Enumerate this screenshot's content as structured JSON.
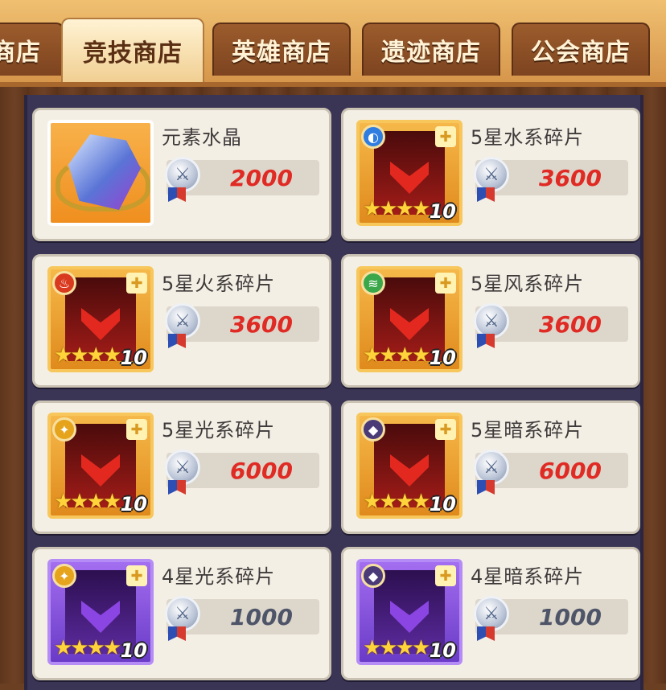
{
  "tabs": [
    {
      "label": "商店",
      "active": false
    },
    {
      "label": "竞技商店",
      "active": true
    },
    {
      "label": "英雄商店",
      "active": false
    },
    {
      "label": "遗迹商店",
      "active": false
    },
    {
      "label": "公会商店",
      "active": false
    }
  ],
  "currency": {
    "icon": "arena-medal-icon",
    "glyph": "⚔"
  },
  "items": [
    {
      "name": "元素水晶",
      "price": "2000",
      "price_color": "#e02a24",
      "thumb": "crystal"
    },
    {
      "name": "5星水系碎片",
      "price": "3600",
      "price_color": "#e02a24",
      "thumb": "orange",
      "element_icon": "water-element-icon",
      "element_glyph": "◐",
      "element_color": "#2f7de0",
      "stars": "★★★★",
      "count": "10"
    },
    {
      "name": "5星火系碎片",
      "price": "3600",
      "price_color": "#e02a24",
      "thumb": "orange",
      "element_icon": "fire-element-icon",
      "element_glyph": "♨",
      "element_color": "#d93a1f",
      "stars": "★★★★",
      "count": "10"
    },
    {
      "name": "5星风系碎片",
      "price": "3600",
      "price_color": "#e02a24",
      "thumb": "orange",
      "element_icon": "wind-element-icon",
      "element_glyph": "≋",
      "element_color": "#3aa84a",
      "stars": "★★★★",
      "count": "10"
    },
    {
      "name": "5星光系碎片",
      "price": "6000",
      "price_color": "#e02a24",
      "thumb": "orange",
      "element_icon": "light-element-icon",
      "element_glyph": "✦",
      "element_color": "#e6a31c",
      "stars": "★★★★",
      "count": "10"
    },
    {
      "name": "5星暗系碎片",
      "price": "6000",
      "price_color": "#e02a24",
      "thumb": "orange",
      "element_icon": "dark-element-icon",
      "element_glyph": "◆",
      "element_color": "#4a3a78",
      "stars": "★★★★",
      "count": "10"
    },
    {
      "name": "4星光系碎片",
      "price": "1000",
      "price_color": "#4f5568",
      "thumb": "purple",
      "element_icon": "light-element-icon",
      "element_glyph": "✦",
      "element_color": "#e6a31c",
      "stars": "★★★★",
      "count": "10"
    },
    {
      "name": "4星暗系碎片",
      "price": "1000",
      "price_color": "#4f5568",
      "thumb": "purple",
      "element_icon": "dark-element-icon",
      "element_glyph": "◆",
      "element_color": "#4a3a78",
      "stars": "★★★★",
      "count": "10"
    }
  ]
}
